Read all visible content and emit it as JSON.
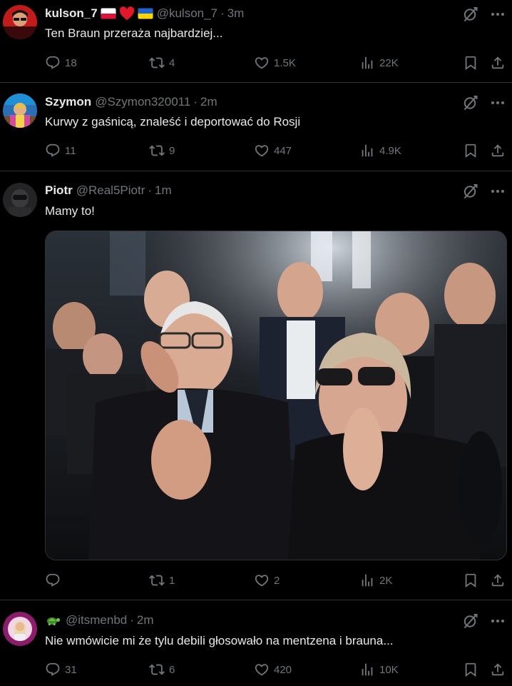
{
  "posts": [
    {
      "name": "kulson_7",
      "handle": "@kulson_7",
      "time": "3m",
      "text": "Ten Braun przeraża najbardziej...",
      "stats": {
        "replies": "18",
        "reposts": "4",
        "likes": "1.5K",
        "views": "22K"
      }
    },
    {
      "name": "Szymon",
      "handle": "@Szymon320011",
      "time": "2m",
      "text": "Kurwy z gaśnicą, znaleść i deportować do Rosji",
      "stats": {
        "replies": "11",
        "reposts": "9",
        "likes": "447",
        "views": "4.9K"
      }
    },
    {
      "name": "Piotr",
      "handle": "@Real5Piotr",
      "time": "1m",
      "text": "Mamy to!",
      "stats": {
        "replies": "",
        "reposts": "1",
        "likes": "2",
        "views": "2K"
      }
    },
    {
      "name": "",
      "handle": "@itsmenbd",
      "time": "2m",
      "text": "Nie wmówicie mi że tylu debili głosowało na mentzena i brauna...",
      "stats": {
        "replies": "31",
        "reposts": "6",
        "likes": "420",
        "views": "10K"
      },
      "avatar_text": "GŁOSUJĘ NA ZANDBERGA"
    }
  ],
  "separator": "·",
  "colors": {
    "background": "#000000",
    "text": "#e7e9ea",
    "muted": "#71767b",
    "border": "#2f3336"
  },
  "icons": [
    "grok-icon",
    "more-icon",
    "reply-icon",
    "repost-icon",
    "like-icon",
    "views-icon",
    "bookmark-icon",
    "share-icon",
    "turtle-emoji-icon",
    "poland-flag-icon",
    "heart-emoji-icon",
    "ukraine-flag-icon"
  ]
}
